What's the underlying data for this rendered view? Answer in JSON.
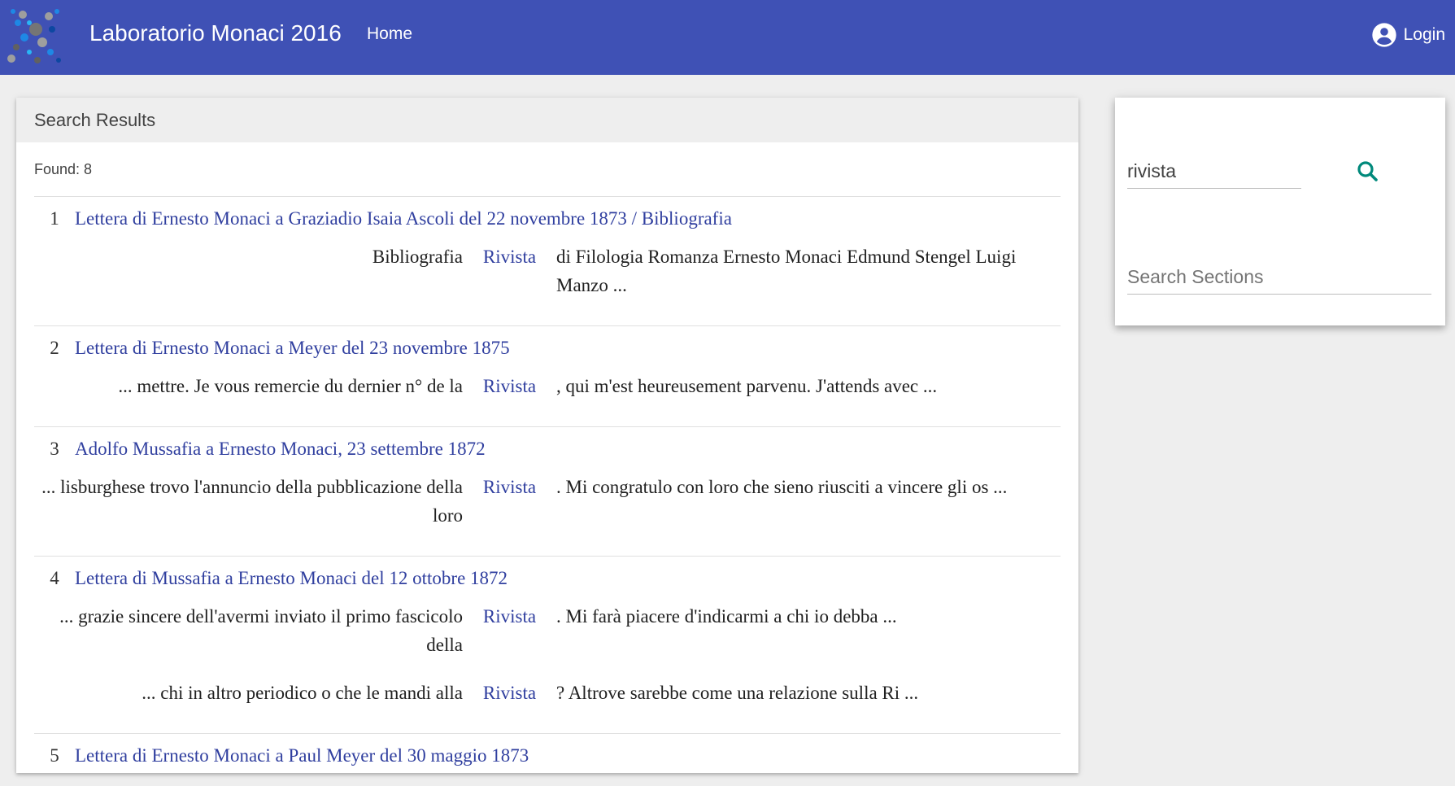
{
  "header": {
    "title": "Laboratorio Monaci 2016",
    "nav_home": "Home",
    "login_label": "Login"
  },
  "results": {
    "heading": "Search Results",
    "found": "Found: 8",
    "items": [
      {
        "num": "1",
        "title": "Lettera di Ernesto Monaci a Graziadio Isaia Ascoli del 22 novembre 1873 / Bibliografia",
        "snippets": [
          {
            "before": "Bibliografia",
            "match": "Rivista",
            "after": "di Filologia Romanza Ernesto Monaci Edmund Stengel Luigi Manzo ..."
          }
        ]
      },
      {
        "num": "2",
        "title": "Lettera di Ernesto Monaci a Meyer del 23 novembre 1875",
        "snippets": [
          {
            "before": "... mettre. Je vous remercie du dernier n° de la",
            "match": "Rivista",
            "after": ", qui m'est heureusement parvenu. J'attends avec ..."
          }
        ]
      },
      {
        "num": "3",
        "title": "Adolfo Mussafia a Ernesto Monaci, 23 settembre 1872",
        "snippets": [
          {
            "before": "... lisburghese trovo l'annuncio della pubblicazione della loro",
            "match": "Rivista",
            "after": ". Mi congratulo con loro che sieno riusciti a vincere gli os ..."
          }
        ]
      },
      {
        "num": "4",
        "title": "Lettera di Mussafia a Ernesto Monaci del 12 ottobre 1872",
        "snippets": [
          {
            "before": "... grazie sincere dell'avermi inviato il primo fascicolo della",
            "match": "Rivista",
            "after": ". Mi farà piacere d'indicarmi a chi io debba ..."
          },
          {
            "before": "... chi in altro periodico o che le mandi alla",
            "match": "Rivista",
            "after": "? Altrove sarebbe come una relazione sulla Ri ..."
          }
        ]
      },
      {
        "num": "5",
        "title": "Lettera di Ernesto Monaci a Paul Meyer del 30 maggio 1873",
        "snippets": []
      }
    ]
  },
  "search": {
    "query_value": "rivista",
    "sections_placeholder": "Search Sections",
    "icon": "search-icon",
    "icon_color": "#00897b"
  },
  "colors": {
    "appbar": "#3f51b5",
    "link": "#303f9f",
    "background": "#eeeeee"
  }
}
